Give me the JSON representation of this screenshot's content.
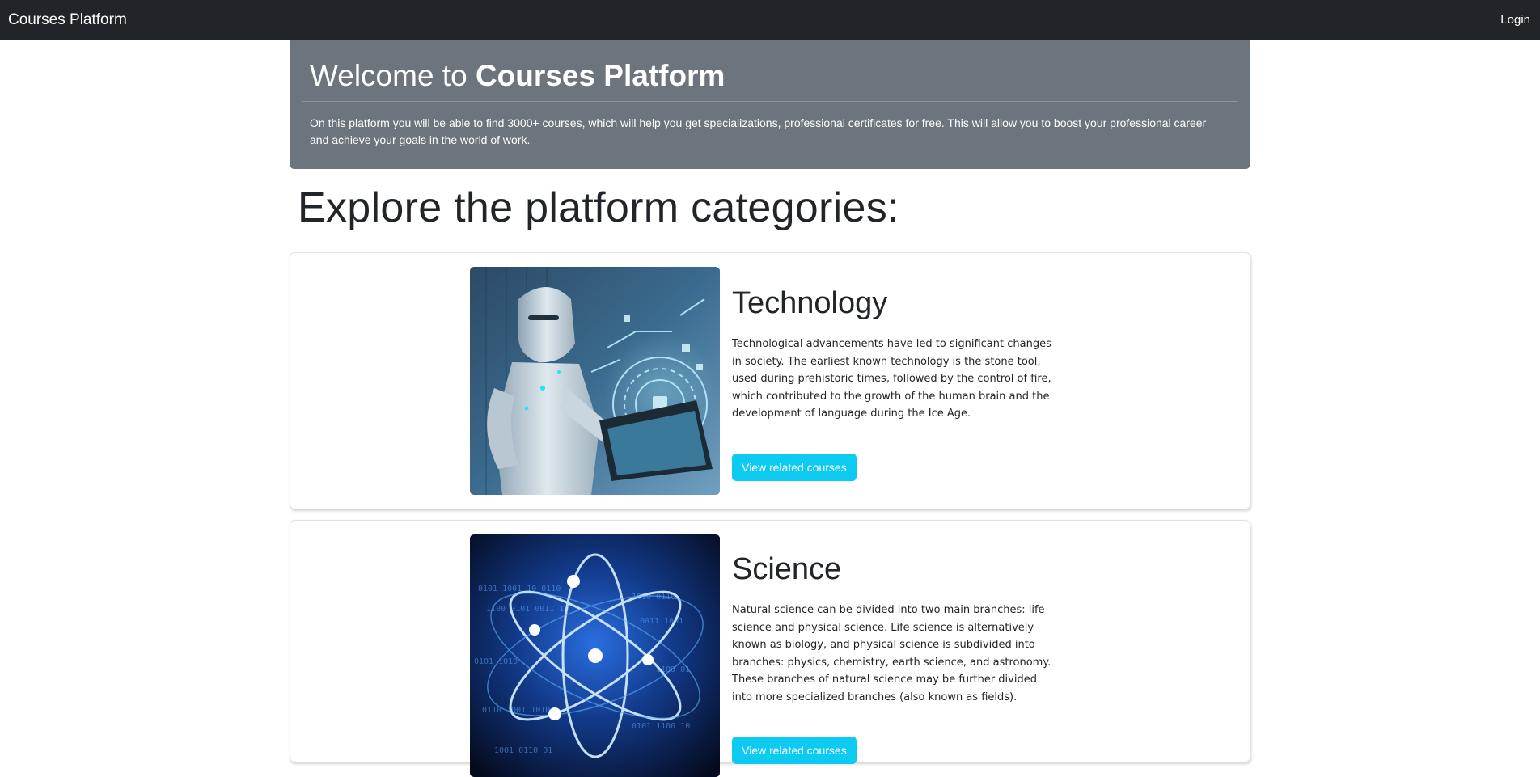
{
  "navbar": {
    "brand": "Courses Platform",
    "login": "Login"
  },
  "hero": {
    "title_prefix": "Welcome to ",
    "title_strong": "Courses Platform",
    "description": "On this platform you will be able to find 3000+ courses, which will help you get specializations, professional certificates for free. This will allow you to boost your professional career and achieve your goals in the world of work."
  },
  "categories_title": "Explore the platform categories:",
  "categories": [
    {
      "title": "Technology",
      "text": "Technological advancements have led to significant changes in society. The earliest known technology is the stone tool, used during prehistoric times, followed by the control of fire, which contributed to the growth of the human brain and the development of language during the Ice Age.",
      "button": "View related courses",
      "image_icon": "robot-laptop-image"
    },
    {
      "title": "Science",
      "text": "Natural science can be divided into two main branches: life science and physical science. Life science is alternatively known as biology, and physical science is subdivided into branches: physics, chemistry, earth science, and astronomy. These branches of natural science may be further divided into more specialized branches (also known as fields).",
      "button": "View related courses",
      "image_icon": "atom-binary-image"
    }
  ],
  "colors": {
    "navbar": "#212529",
    "hero": "#6c757d",
    "button": "#0dcaf0"
  }
}
